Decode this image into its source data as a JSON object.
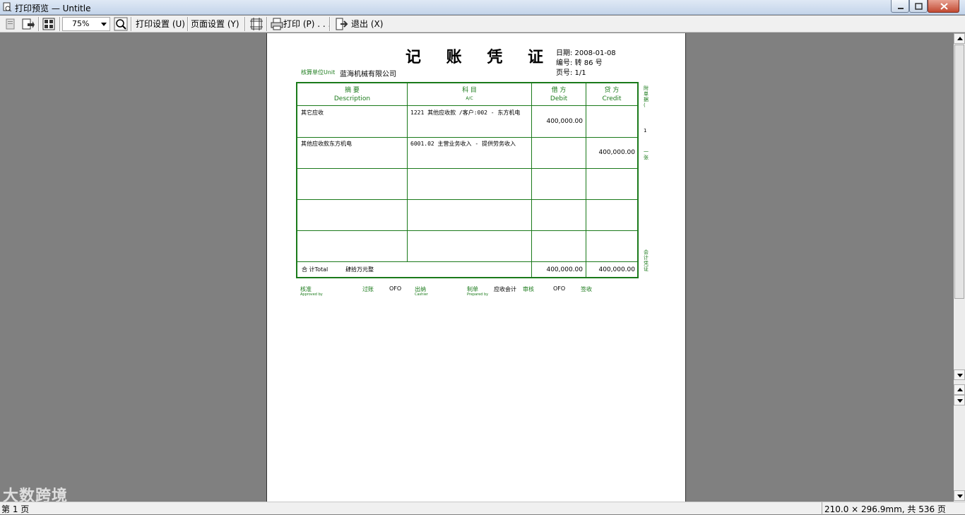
{
  "window": {
    "title": "打印预览 — Untitle"
  },
  "toolbar": {
    "zoom_value": "75%",
    "print_setup": "打印设置 (U)",
    "page_setup": "页面设置 (Y)",
    "print": "打印 (P) . . .",
    "exit": "退出 (X)"
  },
  "voucher": {
    "title": "记 账 凭 证",
    "date": "日期: 2008-01-08",
    "number": "编号: 转 86 号",
    "page": "页号: 1/1",
    "unit_label": "核算单位Unit",
    "unit_value": "蓝海机械有限公司",
    "headers": {
      "summary": "摘    要",
      "summary_en": "Description",
      "account": "科    目",
      "account_en": "A/C",
      "debit": "借  方",
      "debit_en": "Debit",
      "credit": "贷  方",
      "credit_en": "Credit"
    },
    "rows": [
      {
        "summary": "其它应收",
        "account": "1221 其他应收款 /客户:002 - 东方机电",
        "debit": "400,000.00",
        "credit": ""
      },
      {
        "summary": "其他应收款东方机电",
        "account": "6001.02 主营业务收入 - 提供劳务收入",
        "debit": "",
        "credit": "400,000.00"
      },
      {
        "summary": "",
        "account": "",
        "debit": "",
        "credit": ""
      },
      {
        "summary": "",
        "account": "",
        "debit": "",
        "credit": ""
      },
      {
        "summary": "",
        "account": "",
        "debit": "",
        "credit": ""
      }
    ],
    "total_label": "合 计Total",
    "total_words": "肆拾万元整",
    "total_debit": "400,000.00",
    "total_credit": "400,000.00",
    "side_top": "附单据(",
    "side_count": "1",
    "side_mid": "一张",
    "side_bottom": "会计凭证",
    "footer": {
      "approved": "核准",
      "approved_en": "Approved by",
      "posted": "过账",
      "posted_value": "OFO",
      "cashier": "出纳",
      "cashier_en": "Cashier",
      "prepared": "制单",
      "prepared_en": "Prepared by",
      "prepared_value": "应收会计",
      "reviewed": "审核",
      "reviewed_value": "OFO",
      "signed": "签收"
    }
  },
  "status": {
    "page": "第 1 页",
    "size": "210.0 × 296.9mm, 共 536 页"
  },
  "watermark": "大数跨境",
  "colors": {
    "grid_green": "#1a7a1a",
    "workspace_gray": "#808080"
  }
}
